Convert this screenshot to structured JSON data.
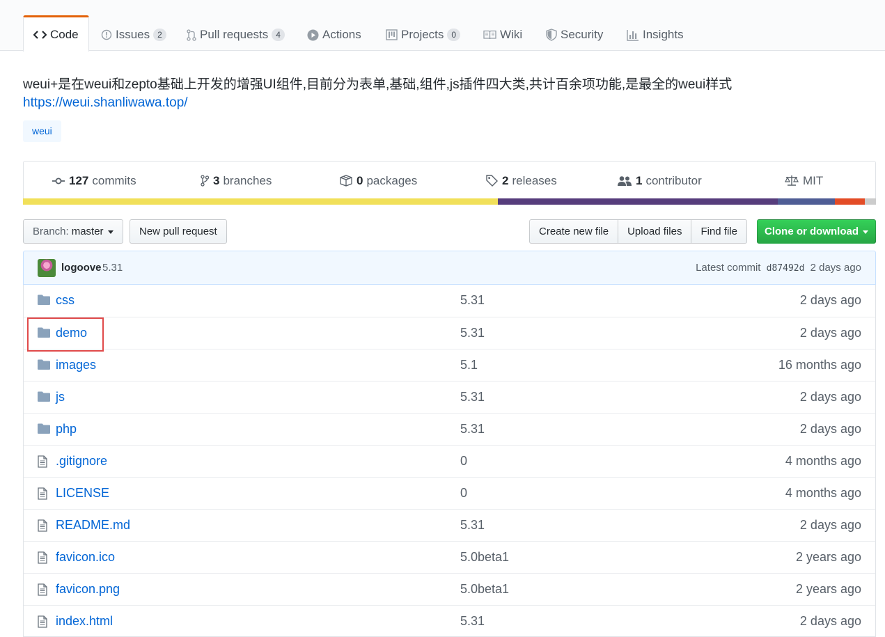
{
  "tabs": [
    {
      "label": "Code",
      "icon": "code-icon",
      "count": null,
      "selected": true
    },
    {
      "label": "Issues",
      "icon": "issue-icon",
      "count": "2"
    },
    {
      "label": "Pull requests",
      "icon": "pull-request-icon",
      "count": "4"
    },
    {
      "label": "Actions",
      "icon": "play-icon",
      "count": null
    },
    {
      "label": "Projects",
      "icon": "project-icon",
      "count": "0"
    },
    {
      "label": "Wiki",
      "icon": "book-icon",
      "count": null
    },
    {
      "label": "Security",
      "icon": "shield-icon",
      "count": null
    },
    {
      "label": "Insights",
      "icon": "graph-icon",
      "count": null
    }
  ],
  "repo": {
    "description": "weui+是在weui和zepto基础上开发的增强UI组件,目前分为表单,基础,组件,js插件四大类,共计百余项功能,是最全的weui样式",
    "homepage": "https://weui.shanliwawa.top/",
    "topic": "weui"
  },
  "summary": {
    "commits": {
      "count": "127",
      "label": "commits"
    },
    "branches": {
      "count": "3",
      "label": "branches"
    },
    "packages": {
      "count": "0",
      "label": "packages"
    },
    "releases": {
      "count": "2",
      "label": "releases"
    },
    "contributors": {
      "count": "1",
      "label": "contributor"
    },
    "license": "MIT"
  },
  "languages": [
    {
      "color": "#f1e05a",
      "share": 0.557
    },
    {
      "color": "#563d7c",
      "share": 0.328
    },
    {
      "color": "#4F5D95",
      "share": 0.067
    },
    {
      "color": "#e34c26",
      "share": 0.035
    },
    {
      "color": "#cccccc",
      "share": 0.013
    }
  ],
  "toolbar": {
    "branch_prefix": "Branch:",
    "branch_name": "master",
    "new_pr": "New pull request",
    "create_file": "Create new file",
    "upload_files": "Upload files",
    "find_file": "Find file",
    "clone": "Clone or download"
  },
  "commit": {
    "author": "logoove",
    "message": "5.31",
    "latest_label": "Latest commit",
    "sha": "d87492d",
    "age": "2 days ago"
  },
  "files": [
    {
      "name": "css",
      "type": "dir",
      "message": "5.31",
      "age": "2 days ago"
    },
    {
      "name": "demo",
      "type": "dir",
      "message": "5.31",
      "age": "2 days ago"
    },
    {
      "name": "images",
      "type": "dir",
      "message": "5.1",
      "age": "16 months ago"
    },
    {
      "name": "js",
      "type": "dir",
      "message": "5.31",
      "age": "2 days ago"
    },
    {
      "name": "php",
      "type": "dir",
      "message": "5.31",
      "age": "2 days ago"
    },
    {
      "name": ".gitignore",
      "type": "file",
      "message": "0",
      "age": "4 months ago"
    },
    {
      "name": "LICENSE",
      "type": "file",
      "message": "0",
      "age": "4 months ago"
    },
    {
      "name": "README.md",
      "type": "file",
      "message": "5.31",
      "age": "2 days ago"
    },
    {
      "name": "favicon.ico",
      "type": "file",
      "message": "5.0beta1",
      "age": "2 years ago"
    },
    {
      "name": "favicon.png",
      "type": "file",
      "message": "5.0beta1",
      "age": "2 years ago"
    },
    {
      "name": "index.html",
      "type": "file",
      "message": "5.31",
      "age": "2 days ago"
    }
  ],
  "highlighted_file": "demo",
  "colors": {
    "accent": "#0366d6",
    "tab_active": "#e36209",
    "primary_button": "#28a745",
    "highlight_box": "#e04a4a"
  }
}
